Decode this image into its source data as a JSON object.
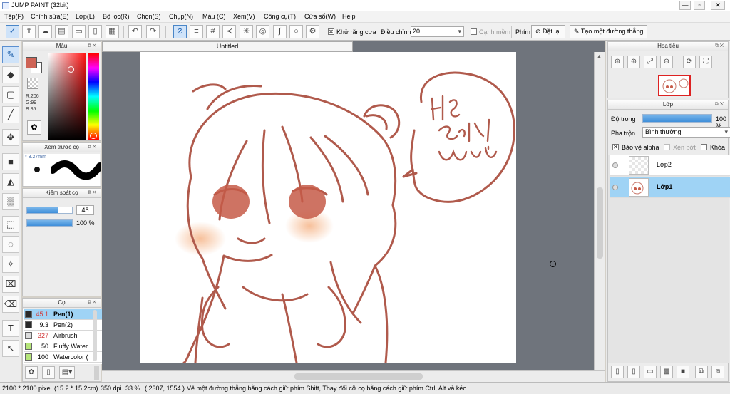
{
  "window": {
    "title": "JUMP PAINT (32bit)",
    "min": "—",
    "max": "▫",
    "close": "✕"
  },
  "menu": [
    "Tệp(F)",
    "Chỉnh sửa(E)",
    "Lớp(L)",
    "Bộ lọc(R)",
    "Chọn(S)",
    "Chụp(N)",
    "Màu (C)",
    "Xem(V)",
    "Công cụ(T)",
    "Cửa sổ(W)",
    "Help"
  ],
  "toolbar": {
    "antialias_label": "Khử răng cưa",
    "adjust_label": "Điều chỉnh",
    "adjust_value": "20",
    "smooth_label": "Cạnh mềm",
    "key_label": "Phím",
    "reset_label": "Đặt lại",
    "straight_label": "Tạo một đường thẳng"
  },
  "color_panel": {
    "title": "Màu",
    "r": "R:206",
    "g": "G:99",
    "b": "B:85",
    "main_color": "#ce6355"
  },
  "brush_preview": {
    "title": "Xem trước cọ",
    "size": "* 3.27mm"
  },
  "brush_control": {
    "title": "Kiểm soát cọ",
    "size_value": "45",
    "size_fraction": 0.68,
    "opacity_value": "100 %",
    "opacity_fraction": 1.0
  },
  "brush_panel": {
    "title": "Cọ",
    "items": [
      {
        "size": "45.1",
        "name": "Pen(1)",
        "color": "#2a2a2a",
        "selected": true
      },
      {
        "size": "9.3",
        "name": "Pen(2)",
        "color": "#2a2a2a",
        "selected": false
      },
      {
        "size": "327",
        "name": "Airbrush",
        "color": "#dcdcdc",
        "selected": false
      },
      {
        "size": "50",
        "name": "Fluffy Water",
        "color": "#b6e67a",
        "selected": false
      },
      {
        "size": "100",
        "name": "Watercolor (",
        "color": "#b6e67a",
        "selected": false
      }
    ]
  },
  "document": {
    "tab": "Untitled",
    "speech_bubble_text": [
      "HS",
      "giỏi",
      "huyền",
      "!"
    ]
  },
  "navigator": {
    "title": "Hoa tiêu"
  },
  "layer_panel": {
    "title": "Lớp",
    "opacity_label": "Độ trong",
    "opacity_value": "100 %",
    "opacity_fraction": 1.0,
    "blend_label": "Pha trộn",
    "blend_value": "Bình thường",
    "protect_alpha": "Bảo vệ alpha",
    "clip": "Xén bớt",
    "lock": "Khóa",
    "layers": [
      {
        "name": "Lớp2",
        "selected": false
      },
      {
        "name": "Lớp1",
        "selected": true
      }
    ]
  },
  "status": {
    "size": "2100 * 2100 pixel",
    "physical": "(15.2 * 15.2cm)",
    "dpi": "350 dpi",
    "zoom": "33 %",
    "coords": "( 2307, 1554 )",
    "hint": "Vẽ một đường thẳng bằng cách giữ phím Shift, Thay đổi cỡ cọ bằng cách giữ phím Ctrl, Alt và kéo"
  },
  "colors": {
    "line": "#b05a4c",
    "eye": "#c65a48",
    "blush": "#f6b98f",
    "accent": "#cfe3f9"
  }
}
